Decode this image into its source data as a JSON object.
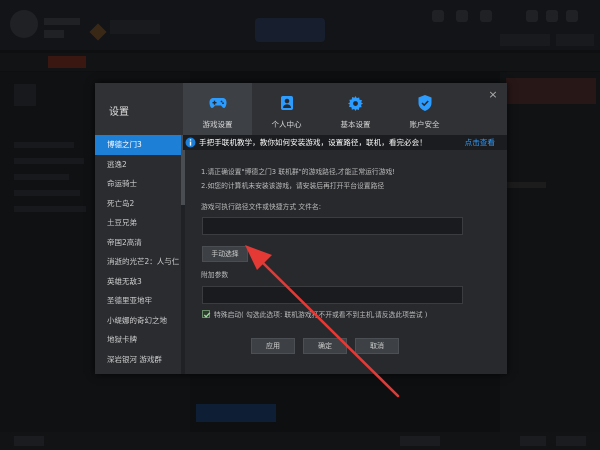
{
  "dialog": {
    "title": "设置",
    "close_symbol": "×"
  },
  "tabs": [
    {
      "label": "游戏设置",
      "icon": "gamepad-icon",
      "active": true
    },
    {
      "label": "个人中心",
      "icon": "user-icon",
      "active": false
    },
    {
      "label": "基本设置",
      "icon": "gear-icon",
      "active": false
    },
    {
      "label": "账户安全",
      "icon": "shield-icon",
      "active": false
    }
  ],
  "sidebar": {
    "items": [
      {
        "label": "博德之门3",
        "active": true
      },
      {
        "label": "逃逸2"
      },
      {
        "label": "命运骑士"
      },
      {
        "label": "死亡岛2"
      },
      {
        "label": "土豆兄弟"
      },
      {
        "label": "帝国2高清"
      },
      {
        "label": "消逝的光芒2：人与仁"
      },
      {
        "label": "英雄无敌3"
      },
      {
        "label": "圣德里亚地牢"
      },
      {
        "label": "小缇娜的奇幻之地"
      },
      {
        "label": "地狱卡牌"
      },
      {
        "label": "深岩银河 游戏群"
      }
    ]
  },
  "banner": {
    "text": "手把手联机教学，教你如何安装游戏，设置路径，联机，看完必会！",
    "link": "点击查看"
  },
  "content": {
    "tip1": "1.请正确设置\"博德之门3 联机群\"的游戏路径,才能正常运行游戏!",
    "tip2": "2.如您的计算机未安装该游戏，请安装后再打开平台设置路径",
    "path_label": "游戏可执行路径文件或快捷方式 文件名:",
    "path_value": "",
    "manual_select": "手动选择",
    "extra_label": "附加参数",
    "extra_value": "",
    "special_start": "特殊启动( 勾选此选项: 联机游戏打不开或看不到主机,请反选此项尝试 )",
    "special_checked": true,
    "apply": "应用",
    "confirm": "确定",
    "cancel": "取消"
  },
  "colors": {
    "accent": "#1e7fd6",
    "annotation": "#e53935",
    "link": "#2d9cff"
  }
}
